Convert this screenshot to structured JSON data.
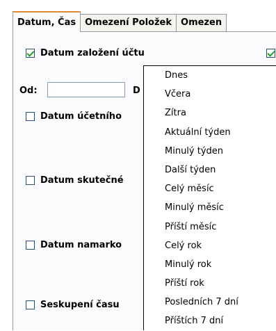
{
  "tabs": [
    "Datum, Čas",
    "Omezení Položek",
    "Omezen"
  ],
  "checkboxes": {
    "datum_zalozeni": {
      "label": "Datum založení účtu",
      "checked": true
    },
    "datum_ucetniho": {
      "label": "Datum účetního",
      "checked": false
    },
    "datum_skutecne": {
      "label": "Datum skutečné",
      "checked": false
    },
    "datum_namarko": {
      "label": "Datum namarko",
      "checked": false
    },
    "seskupeni_casu": {
      "label": "Seskupení času",
      "checked": false
    },
    "right_cut_checkbox": {
      "checked": true
    }
  },
  "range": {
    "from_label": "Od:",
    "from_value": "",
    "to_label": "D"
  },
  "dropdown_options": [
    "Dnes",
    "Včera",
    "Zítra",
    "Aktuální týden",
    "Minulý týden",
    "Další týden",
    "Celý měsíc",
    "Minulý měsíc",
    "Příští měsíc",
    "Celý rok",
    "Minulý rok",
    "Příští rok",
    "Posledních 7 dní",
    "Příštích 7 dní"
  ]
}
